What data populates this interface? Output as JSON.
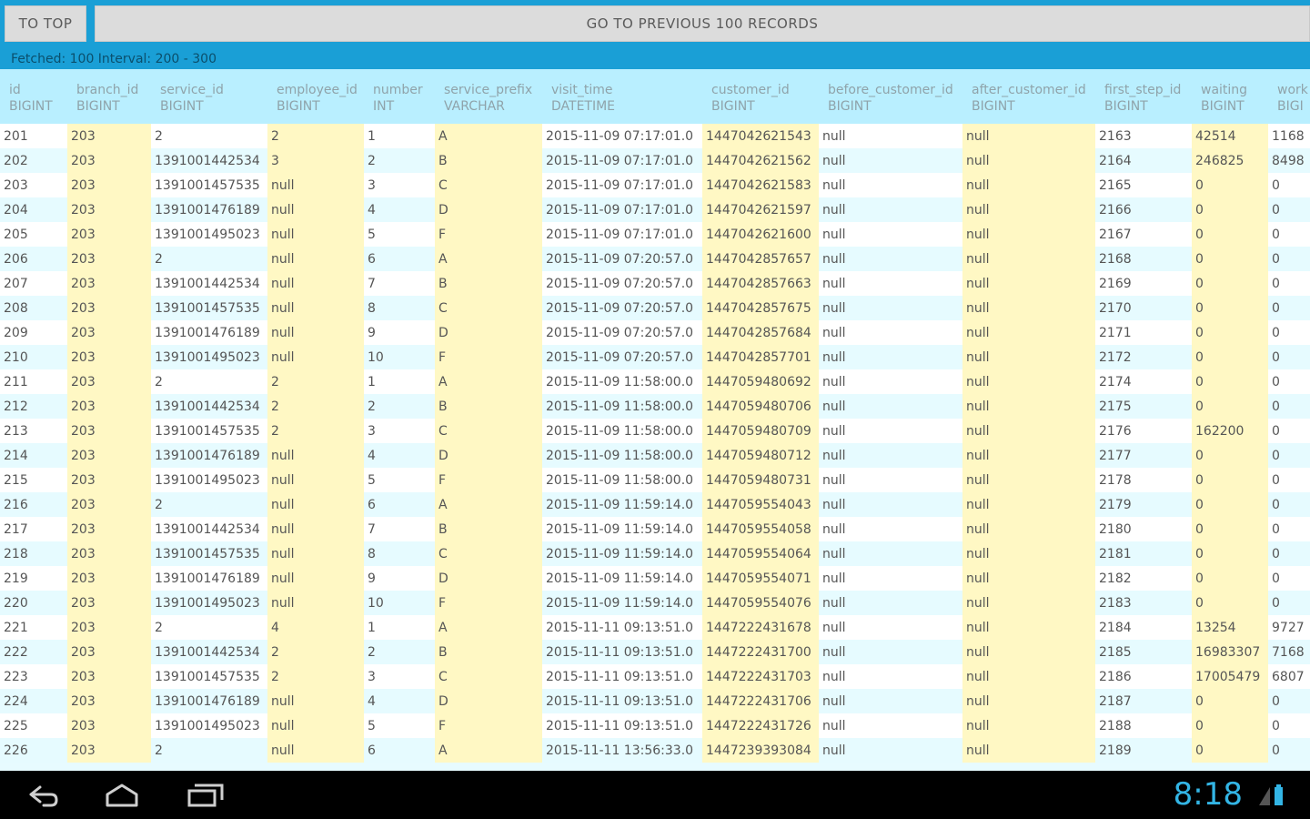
{
  "buttons": {
    "to_top": "TO TOP",
    "prev": "GO TO PREVIOUS 100 RECORDS"
  },
  "status": "Fetched: 100  Interval: 200 - 300",
  "columns": [
    {
      "name": "id",
      "type": "BIGINT"
    },
    {
      "name": "branch_id",
      "type": "BIGINT"
    },
    {
      "name": "service_id",
      "type": "BIGINT"
    },
    {
      "name": "employee_id",
      "type": "BIGINT"
    },
    {
      "name": "number",
      "type": "INT"
    },
    {
      "name": "service_prefix",
      "type": "VARCHAR"
    },
    {
      "name": "visit_time",
      "type": "DATETIME"
    },
    {
      "name": "customer_id",
      "type": "BIGINT"
    },
    {
      "name": "before_customer_id",
      "type": "BIGINT"
    },
    {
      "name": "after_customer_id",
      "type": "BIGINT"
    },
    {
      "name": "first_step_id",
      "type": "BIGINT"
    },
    {
      "name": "waiting",
      "type": "BIGINT"
    },
    {
      "name": "work",
      "type": "BIGI"
    }
  ],
  "rows": [
    [
      "201",
      "203",
      "2",
      "2",
      "1",
      "A",
      "2015-11-09 07:17:01.0",
      "1447042621543",
      "null",
      "null",
      "2163",
      "42514",
      "1168"
    ],
    [
      "202",
      "203",
      "1391001442534",
      "3",
      "2",
      "B",
      "2015-11-09 07:17:01.0",
      "1447042621562",
      "null",
      "null",
      "2164",
      "246825",
      "8498"
    ],
    [
      "203",
      "203",
      "1391001457535",
      "null",
      "3",
      "C",
      "2015-11-09 07:17:01.0",
      "1447042621583",
      "null",
      "null",
      "2165",
      "0",
      "0"
    ],
    [
      "204",
      "203",
      "1391001476189",
      "null",
      "4",
      "D",
      "2015-11-09 07:17:01.0",
      "1447042621597",
      "null",
      "null",
      "2166",
      "0",
      "0"
    ],
    [
      "205",
      "203",
      "1391001495023",
      "null",
      "5",
      "F",
      "2015-11-09 07:17:01.0",
      "1447042621600",
      "null",
      "null",
      "2167",
      "0",
      "0"
    ],
    [
      "206",
      "203",
      "2",
      "null",
      "6",
      "A",
      "2015-11-09 07:20:57.0",
      "1447042857657",
      "null",
      "null",
      "2168",
      "0",
      "0"
    ],
    [
      "207",
      "203",
      "1391001442534",
      "null",
      "7",
      "B",
      "2015-11-09 07:20:57.0",
      "1447042857663",
      "null",
      "null",
      "2169",
      "0",
      "0"
    ],
    [
      "208",
      "203",
      "1391001457535",
      "null",
      "8",
      "C",
      "2015-11-09 07:20:57.0",
      "1447042857675",
      "null",
      "null",
      "2170",
      "0",
      "0"
    ],
    [
      "209",
      "203",
      "1391001476189",
      "null",
      "9",
      "D",
      "2015-11-09 07:20:57.0",
      "1447042857684",
      "null",
      "null",
      "2171",
      "0",
      "0"
    ],
    [
      "210",
      "203",
      "1391001495023",
      "null",
      "10",
      "F",
      "2015-11-09 07:20:57.0",
      "1447042857701",
      "null",
      "null",
      "2172",
      "0",
      "0"
    ],
    [
      "211",
      "203",
      "2",
      "2",
      "1",
      "A",
      "2015-11-09 11:58:00.0",
      "1447059480692",
      "null",
      "null",
      "2174",
      "0",
      "0"
    ],
    [
      "212",
      "203",
      "1391001442534",
      "2",
      "2",
      "B",
      "2015-11-09 11:58:00.0",
      "1447059480706",
      "null",
      "null",
      "2175",
      "0",
      "0"
    ],
    [
      "213",
      "203",
      "1391001457535",
      "2",
      "3",
      "C",
      "2015-11-09 11:58:00.0",
      "1447059480709",
      "null",
      "null",
      "2176",
      "162200",
      "0"
    ],
    [
      "214",
      "203",
      "1391001476189",
      "null",
      "4",
      "D",
      "2015-11-09 11:58:00.0",
      "1447059480712",
      "null",
      "null",
      "2177",
      "0",
      "0"
    ],
    [
      "215",
      "203",
      "1391001495023",
      "null",
      "5",
      "F",
      "2015-11-09 11:58:00.0",
      "1447059480731",
      "null",
      "null",
      "2178",
      "0",
      "0"
    ],
    [
      "216",
      "203",
      "2",
      "null",
      "6",
      "A",
      "2015-11-09 11:59:14.0",
      "1447059554043",
      "null",
      "null",
      "2179",
      "0",
      "0"
    ],
    [
      "217",
      "203",
      "1391001442534",
      "null",
      "7",
      "B",
      "2015-11-09 11:59:14.0",
      "1447059554058",
      "null",
      "null",
      "2180",
      "0",
      "0"
    ],
    [
      "218",
      "203",
      "1391001457535",
      "null",
      "8",
      "C",
      "2015-11-09 11:59:14.0",
      "1447059554064",
      "null",
      "null",
      "2181",
      "0",
      "0"
    ],
    [
      "219",
      "203",
      "1391001476189",
      "null",
      "9",
      "D",
      "2015-11-09 11:59:14.0",
      "1447059554071",
      "null",
      "null",
      "2182",
      "0",
      "0"
    ],
    [
      "220",
      "203",
      "1391001495023",
      "null",
      "10",
      "F",
      "2015-11-09 11:59:14.0",
      "1447059554076",
      "null",
      "null",
      "2183",
      "0",
      "0"
    ],
    [
      "221",
      "203",
      "2",
      "4",
      "1",
      "A",
      "2015-11-11 09:13:51.0",
      "1447222431678",
      "null",
      "null",
      "2184",
      "13254",
      "9727"
    ],
    [
      "222",
      "203",
      "1391001442534",
      "2",
      "2",
      "B",
      "2015-11-11 09:13:51.0",
      "1447222431700",
      "null",
      "null",
      "2185",
      "16983307",
      "7168"
    ],
    [
      "223",
      "203",
      "1391001457535",
      "2",
      "3",
      "C",
      "2015-11-11 09:13:51.0",
      "1447222431703",
      "null",
      "null",
      "2186",
      "17005479",
      "6807"
    ],
    [
      "224",
      "203",
      "1391001476189",
      "null",
      "4",
      "D",
      "2015-11-11 09:13:51.0",
      "1447222431706",
      "null",
      "null",
      "2187",
      "0",
      "0"
    ],
    [
      "225",
      "203",
      "1391001495023",
      "null",
      "5",
      "F",
      "2015-11-11 09:13:51.0",
      "1447222431726",
      "null",
      "null",
      "2188",
      "0",
      "0"
    ],
    [
      "226",
      "203",
      "2",
      "null",
      "6",
      "A",
      "2015-11-11 13:56:33.0",
      "1447239393084",
      "null",
      "null",
      "2189",
      "0",
      "0"
    ]
  ],
  "clock": "8:18",
  "colors": {
    "accent": "#1a9fd6",
    "header_bg": "#b9efff",
    "highlight": "#fff8c4",
    "clock": "#33b5e5"
  },
  "nav_icons": [
    "back-icon",
    "home-icon",
    "recent-apps-icon"
  ]
}
